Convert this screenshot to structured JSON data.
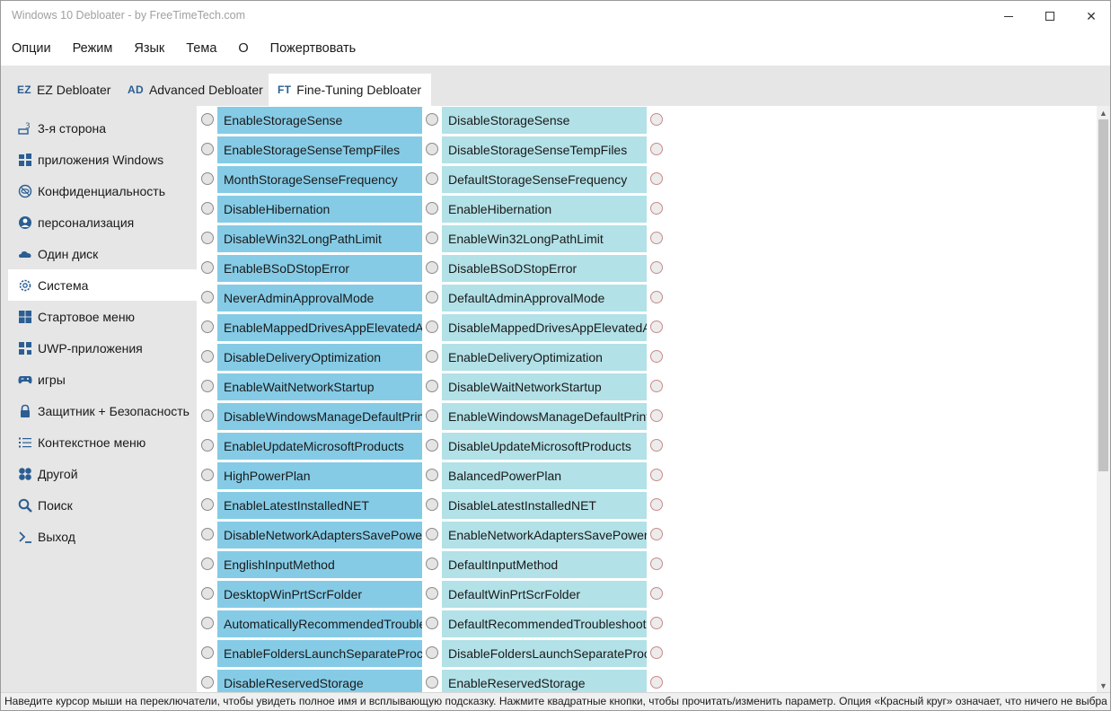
{
  "window": {
    "title": "Windows 10 Debloater - by FreeTimeTech.com"
  },
  "menu": [
    "Опции",
    "Режим",
    "Язык",
    "Тема",
    "О",
    "Пожертвовать"
  ],
  "tabs": [
    {
      "abbr": "EZ",
      "label": "EZ Debloater"
    },
    {
      "abbr": "AD",
      "label": "Advanced Debloater"
    },
    {
      "abbr": "FT",
      "label": "Fine-Tuning Debloater",
      "active": true
    }
  ],
  "sidebar": [
    {
      "icon": "third-party-icon",
      "label": "3-я сторона"
    },
    {
      "icon": "windows-apps-icon",
      "label": "приложения Windows"
    },
    {
      "icon": "privacy-eye-icon",
      "label": "Конфиденциальность"
    },
    {
      "icon": "person-icon",
      "label": "персонализация"
    },
    {
      "icon": "cloud-icon",
      "label": "Один диск"
    },
    {
      "icon": "gear-icon",
      "label": "Система",
      "active": true
    },
    {
      "icon": "start-menu-icon",
      "label": "Стартовое меню"
    },
    {
      "icon": "uwp-apps-icon",
      "label": "UWP-приложения"
    },
    {
      "icon": "gamepad-icon",
      "label": "игры"
    },
    {
      "icon": "lock-icon",
      "label": "Защитник + Безопасность"
    },
    {
      "icon": "list-icon",
      "label": "Контекстное меню"
    },
    {
      "icon": "other-icon",
      "label": "Другой"
    },
    {
      "icon": "search-icon",
      "label": "Поиск"
    },
    {
      "icon": "exit-terminal-icon",
      "label": "Выход"
    }
  ],
  "options": [
    {
      "left": "EnableStorageSense",
      "right": "DisableStorageSense"
    },
    {
      "left": "EnableStorageSenseTempFiles",
      "right": "DisableStorageSenseTempFiles"
    },
    {
      "left": "MonthStorageSenseFrequency",
      "right": "DefaultStorageSenseFrequency"
    },
    {
      "left": "DisableHibernation",
      "right": "EnableHibernation"
    },
    {
      "left": "DisableWin32LongPathLimit",
      "right": "EnableWin32LongPathLimit"
    },
    {
      "left": "EnableBSoDStopError",
      "right": "DisableBSoDStopError"
    },
    {
      "left": "NeverAdminApprovalMode",
      "right": "DefaultAdminApprovalMode"
    },
    {
      "left": "EnableMappedDrivesAppElevatedAc",
      "right": "DisableMappedDrivesAppElevatedA"
    },
    {
      "left": "DisableDeliveryOptimization",
      "right": "EnableDeliveryOptimization"
    },
    {
      "left": "EnableWaitNetworkStartup",
      "right": "DisableWaitNetworkStartup"
    },
    {
      "left": "DisableWindowsManageDefaultPrin",
      "right": "EnableWindowsManageDefaultPrint"
    },
    {
      "left": "EnableUpdateMicrosoftProducts",
      "right": "DisableUpdateMicrosoftProducts"
    },
    {
      "left": "HighPowerPlan",
      "right": "BalancedPowerPlan"
    },
    {
      "left": "EnableLatestInstalledNET",
      "right": "DisableLatestInstalledNET"
    },
    {
      "left": "DisableNetworkAdaptersSavePower",
      "right": "EnableNetworkAdaptersSavePower"
    },
    {
      "left": "EnglishInputMethod",
      "right": "DefaultInputMethod"
    },
    {
      "left": "DesktopWinPrtScrFolder",
      "right": "DefaultWinPrtScrFolder"
    },
    {
      "left": "AutomaticallyRecommendedTrouble",
      "right": "DefaultRecommendedTroubleshooti"
    },
    {
      "left": "EnableFoldersLaunchSeparateProces",
      "right": "DisableFoldersLaunchSeparateProce"
    },
    {
      "left": "DisableReservedStorage",
      "right": "EnableReservedStorage"
    }
  ],
  "status": "Наведите курсор мыши на переключатели, чтобы увидеть полное имя и всплывающую подсказку. Нажмите квадратные кнопки, чтобы прочитать/изменить параметр. Опция «Красный круг» означает, что ничего не выбра",
  "colors": {
    "enable_button": "#85cbe6",
    "disable_button": "#b2e1e7",
    "accent": "#2b5e93"
  }
}
